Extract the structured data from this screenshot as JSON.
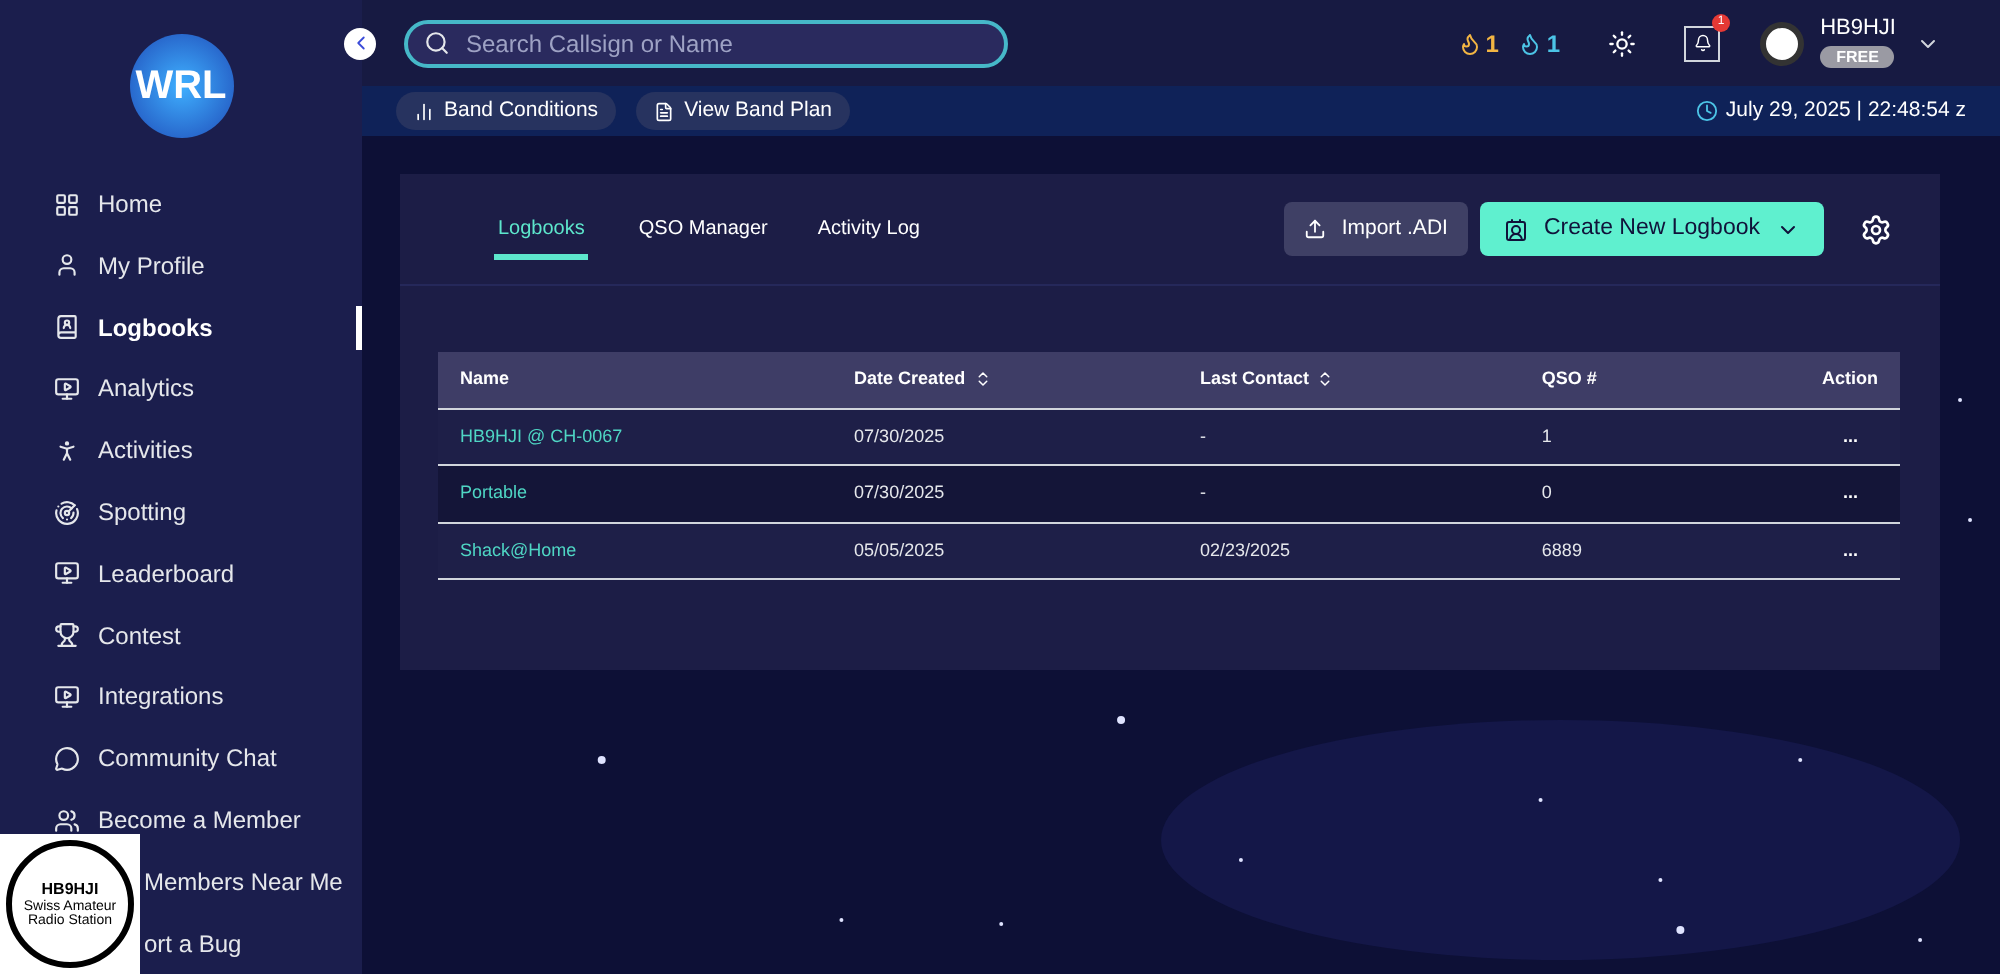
{
  "logo": {
    "text": "WRL"
  },
  "search": {
    "placeholder": "Search Callsign or Name"
  },
  "quick_links": [
    {
      "kind": "conditions",
      "label": "Band Conditions"
    },
    {
      "kind": "plan",
      "label": "View Band Plan"
    }
  ],
  "streaks": [
    {
      "kind": "gold",
      "count": "1"
    },
    {
      "kind": "blue",
      "count": "1"
    }
  ],
  "notifications": {
    "badge": "1"
  },
  "user": {
    "callsign": "HB9HJI",
    "plan": "FREE"
  },
  "clock": "July 29, 2025 | 22:48:54 z",
  "sidebar": {
    "items": [
      {
        "kind": "home",
        "label": "Home",
        "selected": false
      },
      {
        "kind": "profile",
        "label": "My Profile",
        "selected": false
      },
      {
        "kind": "logbook",
        "label": "Logbooks",
        "selected": true
      },
      {
        "kind": "monitor",
        "label": "Analytics",
        "selected": false
      },
      {
        "kind": "activities",
        "label": "Activities",
        "selected": false
      },
      {
        "kind": "spotting",
        "label": "Spotting",
        "selected": false
      },
      {
        "kind": "monitor",
        "label": "Leaderboard",
        "selected": false
      },
      {
        "kind": "trophy",
        "label": "Contest",
        "selected": false
      },
      {
        "kind": "monitor",
        "label": "Integrations",
        "selected": false
      },
      {
        "kind": "chat",
        "label": "Community Chat",
        "selected": false
      },
      {
        "kind": "members",
        "label": "Become a Member",
        "selected": false
      },
      {
        "kind": "covered",
        "label": "Members Near Me",
        "selected": false
      },
      {
        "kind": "covered",
        "label": "ort a Bug",
        "selected": false
      }
    ]
  },
  "station_logo": {
    "callsign": "HB9HJI",
    "subtitle": "Swiss Amateur Radio Station"
  },
  "tabs": [
    {
      "label": "Logbooks",
      "selected": true
    },
    {
      "label": "QSO Manager",
      "selected": false
    },
    {
      "label": "Activity Log",
      "selected": false
    }
  ],
  "buttons": {
    "import": "Import .ADI",
    "create": "Create New Logbook"
  },
  "table": {
    "columns": [
      {
        "label": "Name",
        "sortable": false
      },
      {
        "label": "Date Created",
        "sortable": true
      },
      {
        "label": "Last Contact",
        "sortable": true
      },
      {
        "label": "QSO #",
        "sortable": false
      },
      {
        "label": "Action",
        "sortable": false
      }
    ],
    "rows": [
      [
        "HB9HJI @ CH-0067",
        "07/30/2025",
        "-",
        "1",
        "..."
      ],
      [
        "Portable",
        "07/30/2025",
        "-",
        "0",
        "..."
      ],
      [
        "Shack@Home",
        "05/05/2025",
        "02/23/2025",
        "6889",
        "..."
      ]
    ]
  }
}
